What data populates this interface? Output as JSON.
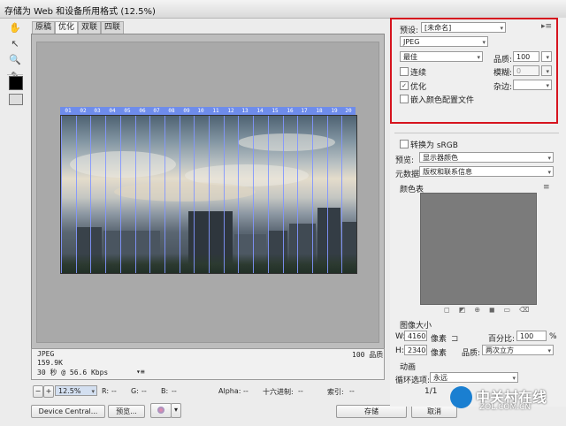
{
  "window": {
    "title": "存储为 Web 和设备所用格式 (12.5%)"
  },
  "tools": [
    "hand-tool-icon",
    "slice-select-icon",
    "zoom-icon",
    "eyedropper-icon"
  ],
  "tabs": [
    {
      "label": "原稿",
      "active": false
    },
    {
      "label": "优化",
      "active": true
    },
    {
      "label": "双联",
      "active": false
    },
    {
      "label": "四联",
      "active": false
    }
  ],
  "slices": [
    "01",
    "02",
    "03",
    "04",
    "05",
    "06",
    "07",
    "08",
    "09",
    "10",
    "11",
    "12",
    "13",
    "14",
    "15",
    "16",
    "17",
    "18",
    "19",
    "20"
  ],
  "image_info": {
    "format": "JPEG",
    "size": "159.9K",
    "time": "30 秒 @ 56.6 Kbps",
    "quality": "100 品质"
  },
  "status": {
    "zoom": "12.5%",
    "r": "R:",
    "g": "G:",
    "b": "B:",
    "r_val": "--",
    "g_val": "--",
    "b_val": "--",
    "alpha": "Alpha:",
    "alpha_val": "--",
    "hex": "十六进制:",
    "hex_val": "--",
    "index": "索引:",
    "index_val": "--"
  },
  "bottom_buttons": {
    "device_central": "Device Central...",
    "preview": "预览...",
    "save": "存储",
    "cancel": "取消"
  },
  "settings": {
    "preset_label": "预设:",
    "preset_value": "[未命名]",
    "format": "JPEG",
    "quality_level": "最佳",
    "quality_label": "品质:",
    "quality_value": "100",
    "progressive": "连续",
    "progressive_checked": false,
    "blur_label": "模糊:",
    "blur_value": "0",
    "optimized": "优化",
    "optimized_checked": true,
    "matte_label": "杂边:",
    "embed_profile": "嵌入颜色配置文件",
    "embed_checked": false,
    "convert_srgb": "转换为 sRGB",
    "convert_checked": false,
    "preview_label": "预览:",
    "preview_value": "显示器颜色",
    "metadata_label": "元数据:",
    "metadata_value": "版权和联系信息"
  },
  "color_table": {
    "title": "颜色表"
  },
  "image_size": {
    "title": "图像大小",
    "w_label": "W:",
    "w_value": "4160",
    "h_label": "H:",
    "h_value": "2340",
    "unit": "像素",
    "percent_label": "百分比:",
    "percent_value": "100",
    "percent_unit": "%",
    "quality_label": "品质:",
    "quality_value": "两次立方"
  },
  "animation": {
    "title": "动画",
    "loop_label": "循环选项:",
    "loop_value": "永远",
    "frame": "1/1"
  },
  "watermark": {
    "name": "中关村在线",
    "url": "ZOL.COM.CN"
  },
  "colors": {
    "highlight_box": "#d6141e",
    "slice_blue": "#6e8ceb"
  }
}
